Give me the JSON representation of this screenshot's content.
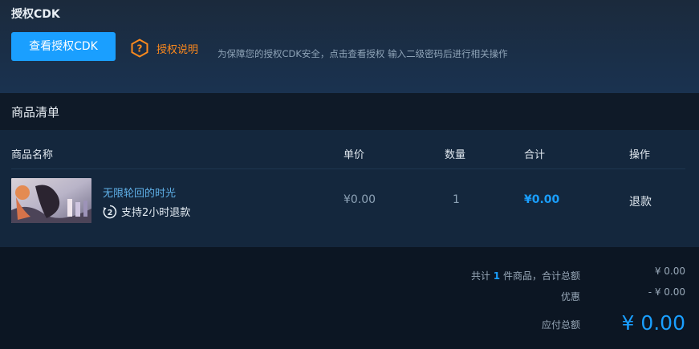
{
  "cdk": {
    "title": "授权CDK",
    "view_button": "查看授权CDK",
    "help_label": "授权说明",
    "note": "为保障您的授权CDK安全，点击查看授权 输入二级密码后进行相关操作"
  },
  "list": {
    "title": "商品清单",
    "columns": {
      "name": "商品名称",
      "price": "单价",
      "qty": "数量",
      "total": "合计",
      "action": "操作"
    },
    "items": [
      {
        "name": "无限轮回的时光",
        "refund_note": "支持2小时退款",
        "refund_icon": "two-hour-refund-icon",
        "price": "¥0.00",
        "qty": "1",
        "total": "¥0.00",
        "action": "退款"
      }
    ]
  },
  "summary": {
    "count_prefix": "共计",
    "count": "1",
    "count_suffix": "件商品，合计总额",
    "subtotal": "¥ 0.00",
    "discount_label": "优惠",
    "discount": "- ¥ 0.00",
    "payable_label": "应付总额",
    "payable": "¥ 0.00"
  },
  "colors": {
    "accent": "#1a9fff",
    "help": "#ff8a1c",
    "link": "#5fb0e8"
  }
}
